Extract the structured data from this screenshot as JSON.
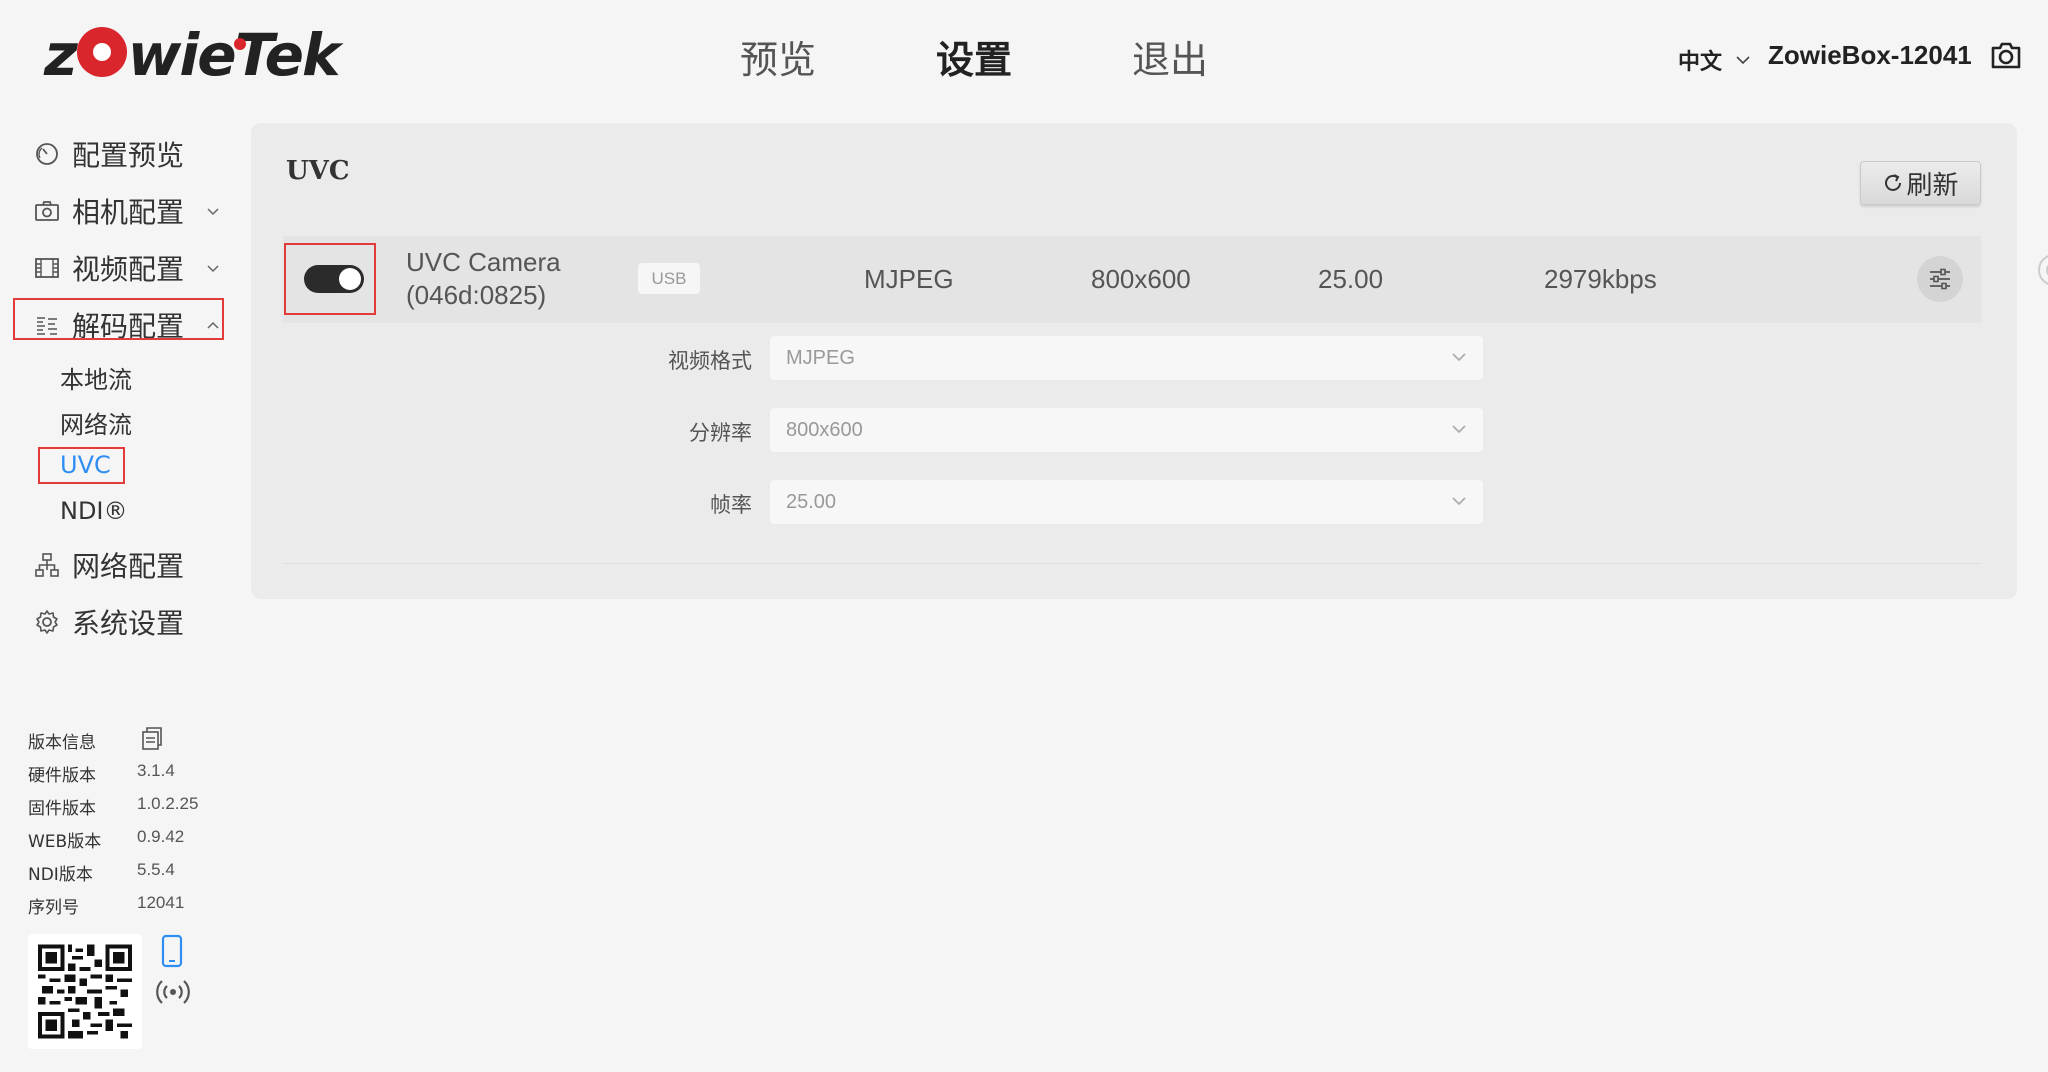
{
  "brand": {
    "logo_text_before": "z",
    "logo_text_after": "wieTek",
    "logo_red": "#d8262c"
  },
  "top_nav": {
    "preview": "预览",
    "settings": "设置",
    "logout": "退出"
  },
  "header": {
    "language": "中文",
    "device_name": "ZowieBox-12041"
  },
  "sidebar": {
    "items": {
      "overview": "配置预览",
      "camera": "相机配置",
      "video": "视频配置",
      "decode": "解码配置",
      "network": "网络配置",
      "system": "系统设置"
    },
    "decode_sub": {
      "local": "本地流",
      "net": "网络流",
      "uvc": "UVC",
      "ndi": "NDI®"
    }
  },
  "version_info": {
    "title": "版本信息",
    "rows": [
      {
        "label": "硬件版本",
        "value": "3.1.4"
      },
      {
        "label": "固件版本",
        "value": "1.0.2.25"
      },
      {
        "label": "WEB版本",
        "value": "0.9.42"
      },
      {
        "label": "NDI版本",
        "value": "5.5.4"
      },
      {
        "label": "序列号",
        "value": "12041"
      }
    ]
  },
  "main": {
    "title": "UVC",
    "refresh_label": "刷新",
    "device": {
      "enabled": true,
      "name_line1": "UVC Camera",
      "name_line2": "(046d:0825)",
      "interface": "USB",
      "format": "MJPEG",
      "resolution": "800x600",
      "fps": "25.00",
      "bitrate": "2979kbps"
    },
    "form": {
      "format_label": "视频格式",
      "format_value": "MJPEG",
      "resolution_label": "分辨率",
      "resolution_value": "800x600",
      "fps_label": "帧率",
      "fps_value": "25.00"
    }
  },
  "colors": {
    "accent": "#2f8ef4",
    "highlight_box": "#e33a3a",
    "background": "#f5f5f5"
  }
}
